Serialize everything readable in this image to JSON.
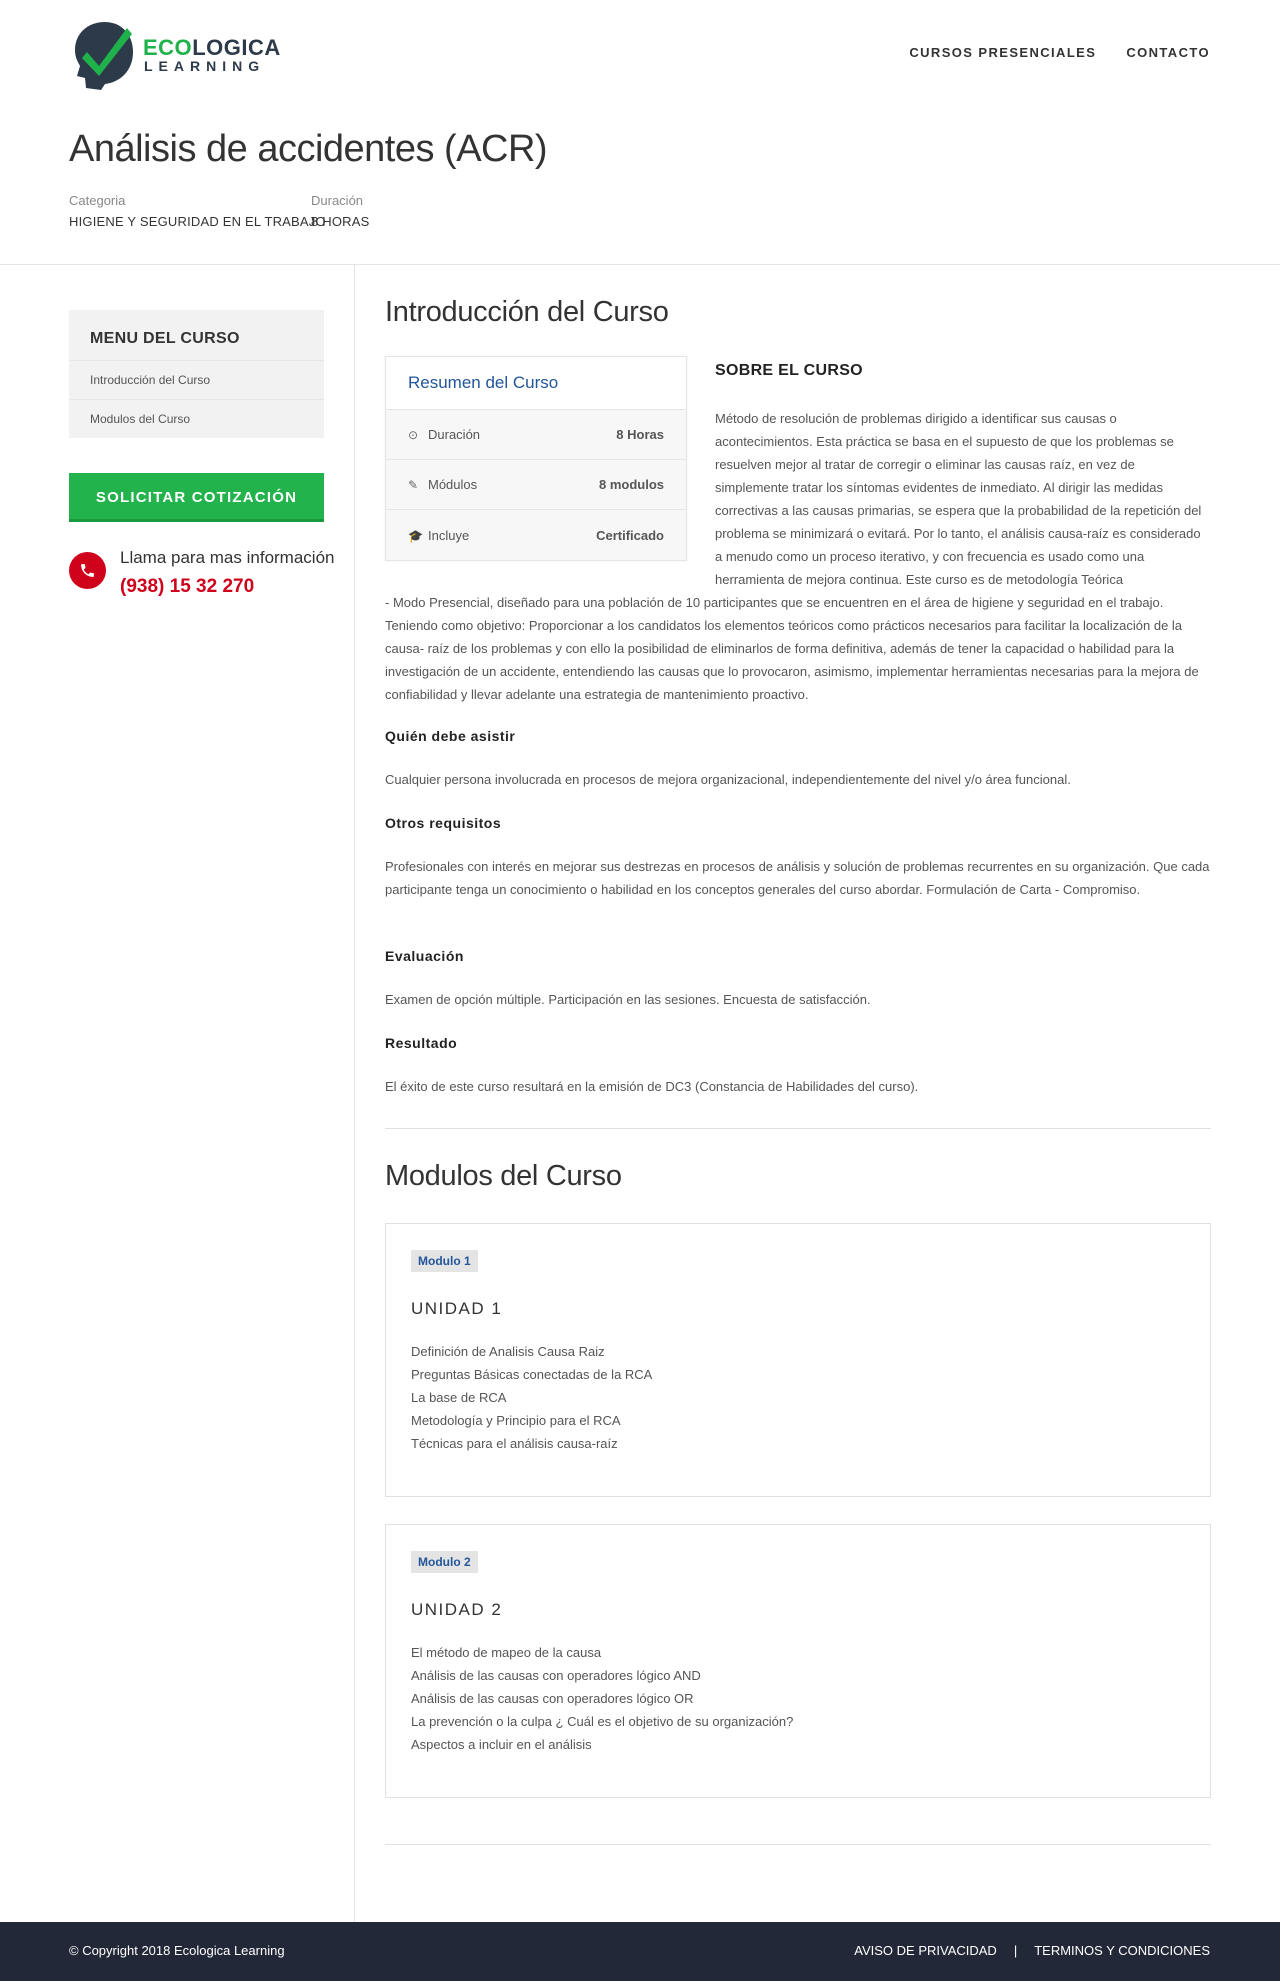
{
  "brand": {
    "line1_green": "ECO",
    "line1_dark": "LOGICA",
    "line2": "LEARNING"
  },
  "nav": {
    "items": [
      "CURSOS PRESENCIALES",
      "CONTACTO"
    ]
  },
  "page": {
    "title": "Análisis de accidentes (ACR)",
    "category_label": "Categoria",
    "category_value": "HIGIENE Y SEGURIDAD EN EL TRABAJO",
    "duration_label": "Duración",
    "duration_value": "8 HORAS"
  },
  "sidebar": {
    "menu_title": "MENU DEL CURSO",
    "items": [
      "Introducción del Curso",
      "Modulos del Curso"
    ],
    "quote_button": "SOLICITAR COTIZACIÓN",
    "call_text": "Llama para mas información",
    "phone": "(938) 15 32 270"
  },
  "intro": {
    "title": "Introducción del Curso",
    "summary": {
      "title": "Resumen del Curso",
      "rows": [
        {
          "icon": "clock-icon",
          "label": "Duración",
          "value": "8 Horas"
        },
        {
          "icon": "edit-icon",
          "label": "Módulos",
          "value": "8 modulos"
        },
        {
          "icon": "graduation-cap-icon",
          "label": "Incluye",
          "value": "Certificado"
        }
      ]
    },
    "about_title": "SOBRE EL CURSO",
    "about_text": "Método de resolución de problemas dirigido a identificar sus causas o acontecimientos. Esta práctica se basa en el supuesto de que los problemas se resuelven mejor al tratar de corregir o eliminar las causas raíz, en vez de simplemente tratar los síntomas evidentes de inmediato. Al dirigir las medidas correctivas a las causas primarias, se espera que la probabilidad de la repetición del problema se minimizará o evitará. Por lo tanto, el análisis causa-raíz es considerado a menudo como un proceso iterativo, y con frecuencia es usado como una herramienta de mejora continua. Este curso es de metodología Teórica",
    "about_text_cont": "- Modo Presencial, diseñado para una población de 10 participantes que se encuentren en el área de higiene y seguridad en el trabajo. Teniendo como objetivo: Proporcionar a los candidatos los elementos teóricos como prácticos necesarios para facilitar la localización de la causa- raíz de los problemas y con ello la posibilidad de eliminarlos de forma definitiva, además de tener la capacidad o habilidad para la investigación de un accidente, entendiendo las causas que lo provocaron, asimismo, implementar herramientas necesarias para la mejora de confiabilidad y llevar adelante una estrategia de mantenimiento proactivo.",
    "sections": [
      {
        "title": "Quién debe asistir",
        "text": "Cualquier persona involucrada en procesos de mejora organizacional, independientemente del nivel y/o área funcional."
      },
      {
        "title": "Otros requisitos",
        "text": "Profesionales con interés en mejorar sus destrezas en procesos de análisis y solución de problemas recurrentes en su organización. Que cada participante tenga un conocimiento o habilidad en los conceptos generales del curso abordar. Formulación de Carta - Compromiso."
      },
      {
        "title": "Evaluación",
        "text": "Examen de opción múltiple. Participación en las sesiones. Encuesta de satisfacción."
      },
      {
        "title": "Resultado",
        "text": "El éxito de este curso resultará en la emisión de DC3 (Constancia de Habilidades del curso)."
      }
    ]
  },
  "modules": {
    "title": "Modulos del Curso",
    "list": [
      {
        "badge": "Modulo 1",
        "unit": "UNIDAD 1",
        "items": [
          "Definición de Analisis Causa Raiz",
          "Preguntas Básicas conectadas de la RCA",
          "La base de RCA",
          "Metodología y Principio para el RCA",
          "Técnicas para el análisis causa-raíz"
        ]
      },
      {
        "badge": "Modulo 2",
        "unit": "UNIDAD 2",
        "items": [
          "El método de mapeo de la causa",
          "Análisis de las causas con operadores lógico AND",
          "Análisis de las causas con operadores lógico OR",
          "La prevención o la culpa ¿ Cuál es el objetivo de su organización?",
          "Aspectos a incluir en el análisis"
        ]
      }
    ]
  },
  "footer": {
    "copyright": "© Copyright 2018 Ecologica Learning",
    "links": [
      "AVISO DE PRIVACIDAD",
      "|",
      "TERMINOS Y CONDICIONES"
    ]
  },
  "colors": {
    "accent_green": "#22b34c",
    "brand_blue": "#23569a",
    "phone_red": "#d0021b",
    "footer_bg": "#232838"
  }
}
